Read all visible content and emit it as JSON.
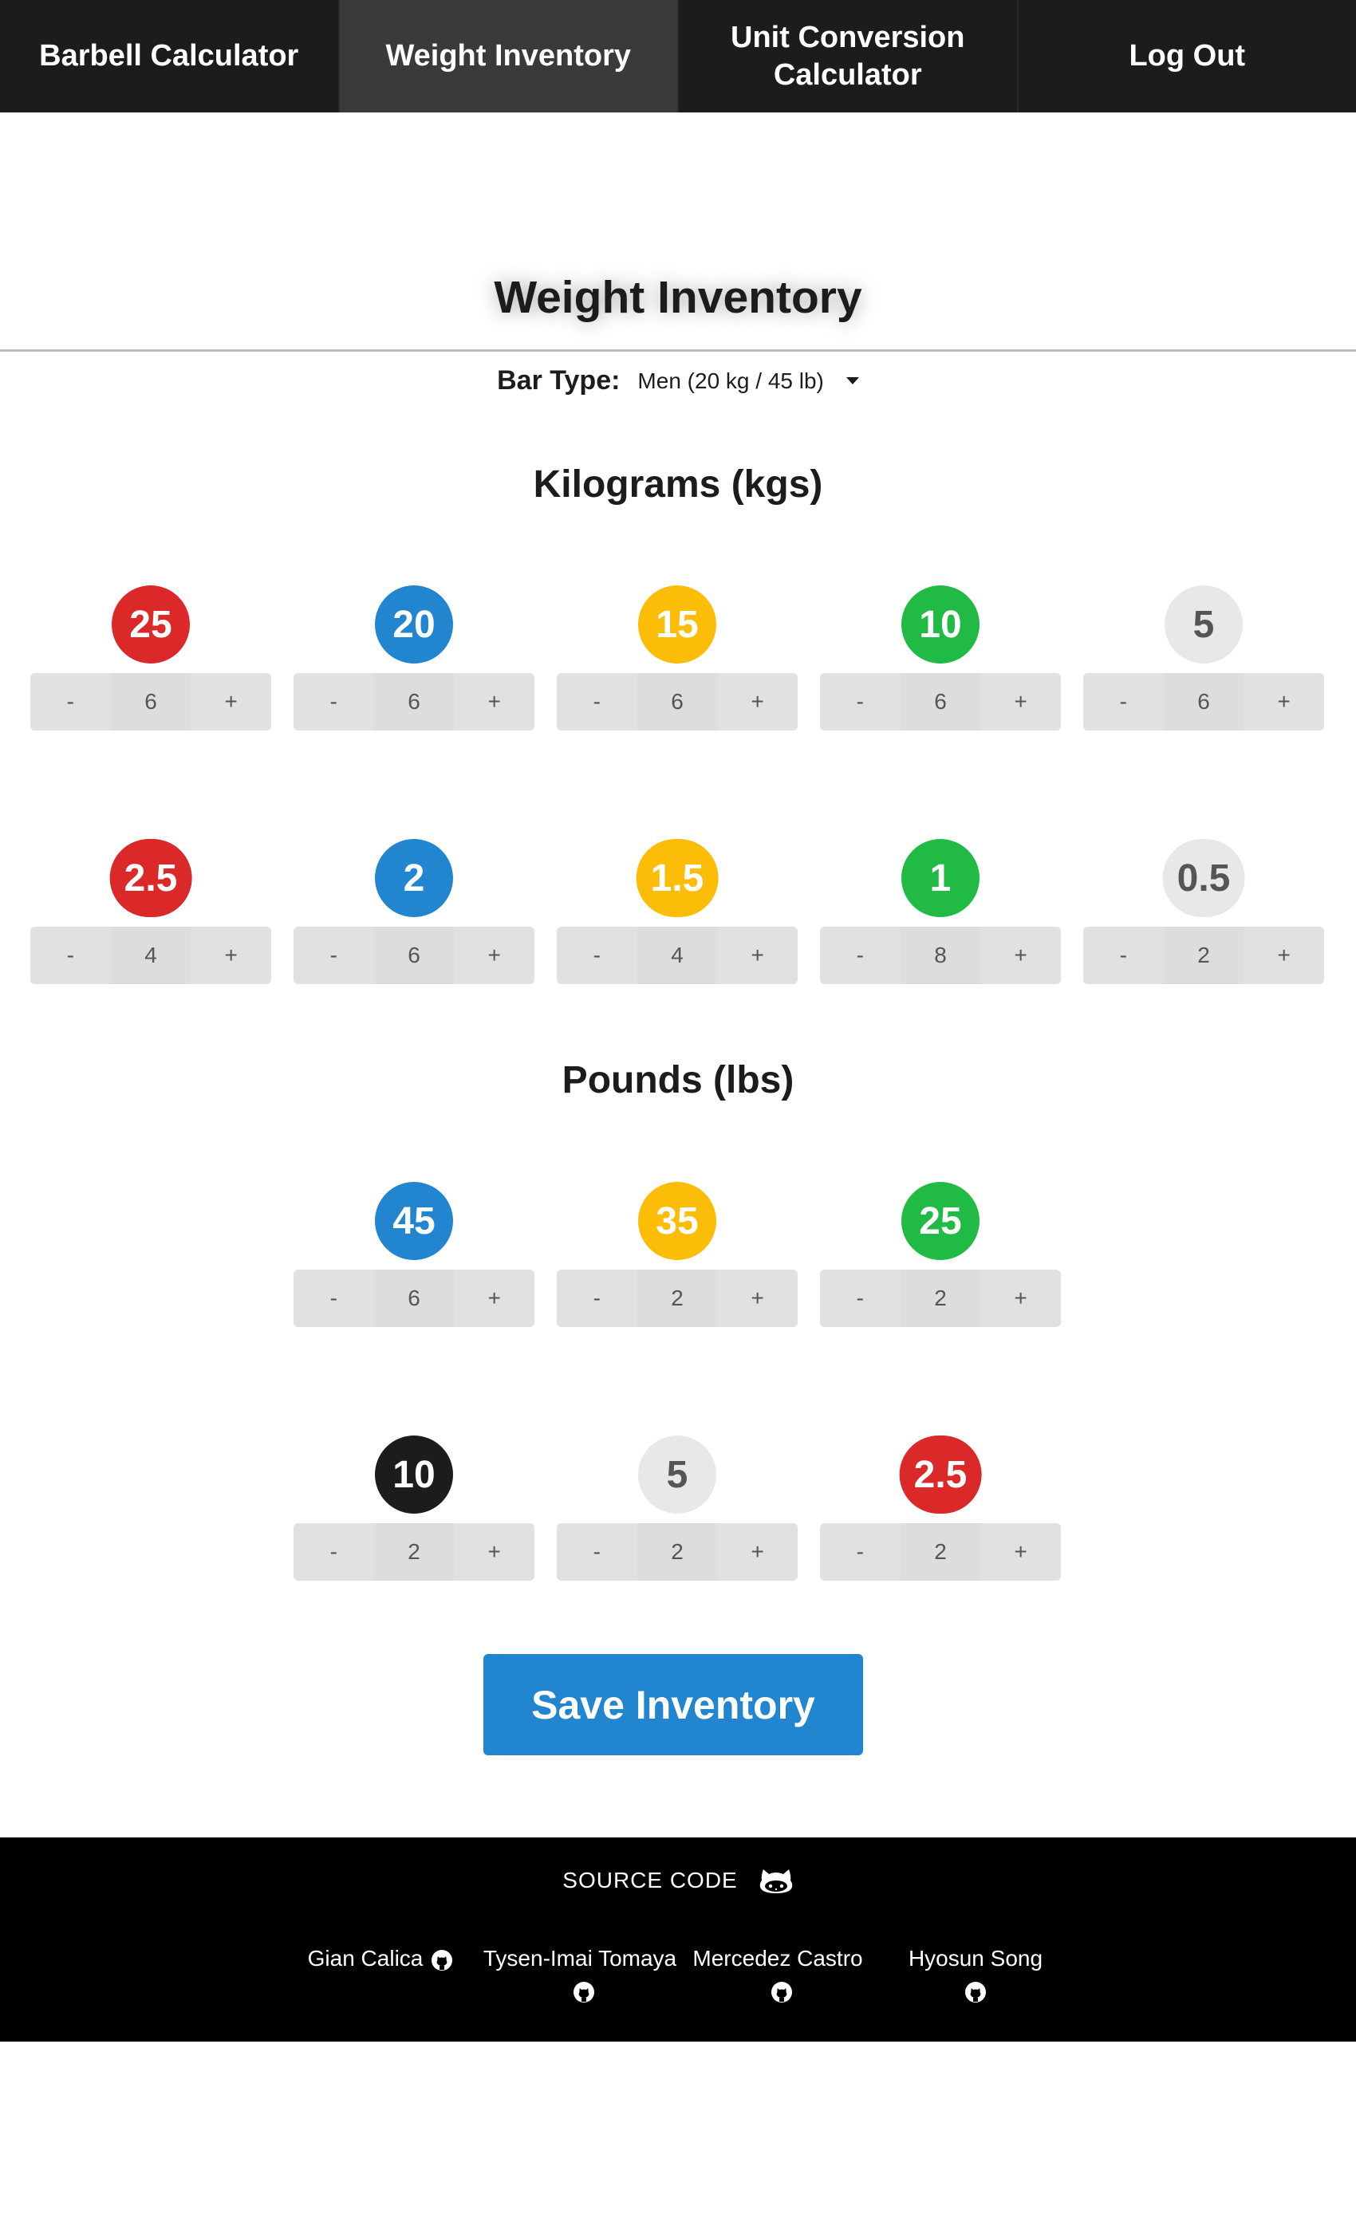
{
  "nav": {
    "items": [
      {
        "label": "Barbell Calculator",
        "active": false
      },
      {
        "label": "Weight Inventory",
        "active": true
      },
      {
        "label": "Unit Conversion Calculator",
        "active": false
      },
      {
        "label": "Log Out",
        "active": false
      }
    ]
  },
  "header": {
    "title": "Weight Inventory",
    "bar_type_label": "Bar Type:",
    "bar_type_value": "Men (20 kg / 45 lb)"
  },
  "kilograms": {
    "title": "Kilograms (kgs)",
    "plates": [
      {
        "weight": "25",
        "count": "6",
        "color": "#db2828"
      },
      {
        "weight": "20",
        "count": "6",
        "color": "#2185d0"
      },
      {
        "weight": "15",
        "count": "6",
        "color": "#fbbd08"
      },
      {
        "weight": "10",
        "count": "6",
        "color": "#21ba45"
      },
      {
        "weight": "5",
        "count": "6",
        "color": "#e8e8e8"
      },
      {
        "weight": "2.5",
        "count": "4",
        "color": "#db2828"
      },
      {
        "weight": "2",
        "count": "6",
        "color": "#2185d0"
      },
      {
        "weight": "1.5",
        "count": "4",
        "color": "#fbbd08"
      },
      {
        "weight": "1",
        "count": "8",
        "color": "#21ba45"
      },
      {
        "weight": "0.5",
        "count": "2",
        "color": "#e8e8e8"
      }
    ]
  },
  "pounds": {
    "title": "Pounds (lbs)",
    "plates": [
      {
        "weight": "45",
        "count": "6",
        "color": "#2185d0"
      },
      {
        "weight": "35",
        "count": "2",
        "color": "#fbbd08"
      },
      {
        "weight": "25",
        "count": "2",
        "color": "#21ba45"
      },
      {
        "weight": "10",
        "count": "2",
        "color": "#1b1c1d"
      },
      {
        "weight": "5",
        "count": "2",
        "color": "#e8e8e8"
      },
      {
        "weight": "2.5",
        "count": "2",
        "color": "#db2828"
      }
    ]
  },
  "stepper": {
    "minus": "-",
    "plus": "+"
  },
  "save_label": "Save Inventory",
  "footer": {
    "source_label": "SOURCE CODE",
    "authors": [
      "Gian Calica",
      "Tysen-Imai Tomaya",
      "Mercedez Castro",
      "Hyosun Song"
    ]
  }
}
